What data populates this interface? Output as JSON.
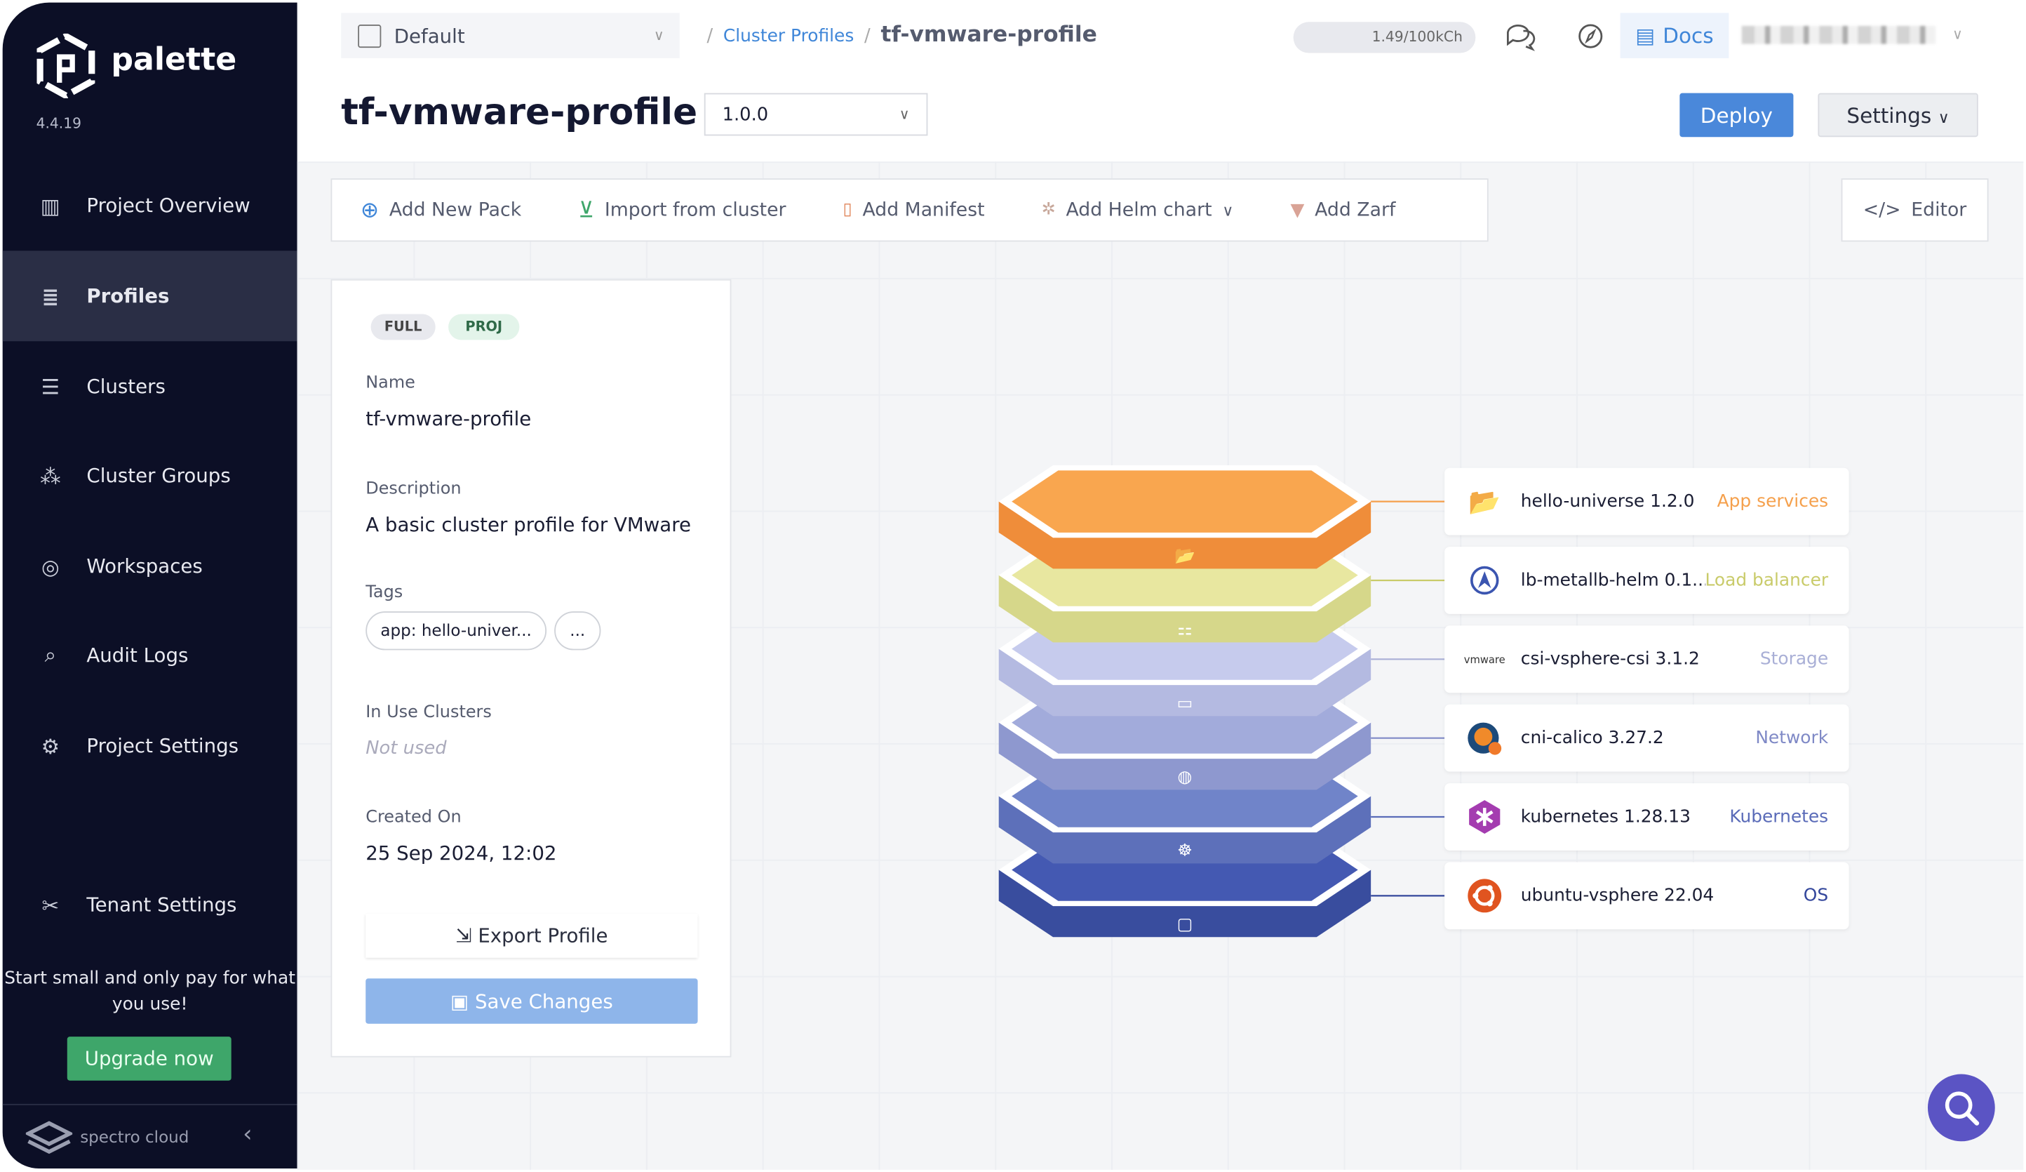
{
  "sidebar": {
    "logo": "palette",
    "version": "4.4.19",
    "items": [
      {
        "label": "Project Overview",
        "icon": "chart-icon",
        "active": false
      },
      {
        "label": "Profiles",
        "icon": "database-icon",
        "active": true
      },
      {
        "label": "Clusters",
        "icon": "server-icon",
        "active": false
      },
      {
        "label": "Cluster Groups",
        "icon": "network-icon",
        "active": false
      },
      {
        "label": "Workspaces",
        "icon": "target-icon",
        "active": false
      },
      {
        "label": "Audit Logs",
        "icon": "search-doc-icon",
        "active": false
      },
      {
        "label": "Project Settings",
        "icon": "gear-icon",
        "active": false
      },
      {
        "label": "Tenant Settings",
        "icon": "tools-icon",
        "active": false
      }
    ],
    "promo": "Start small and only pay for what you use!",
    "upgrade_label": "Upgrade now",
    "footer_logo": "spectro cloud"
  },
  "header": {
    "project": "Default",
    "breadcrumb": [
      "Cluster Profiles",
      "tf-vmware-profile"
    ],
    "usage": "1.49/100kCh",
    "docs_label": "Docs"
  },
  "profile": {
    "title": "tf-vmware-profile",
    "version": "1.0.0",
    "deploy_label": "Deploy",
    "settings_label": "Settings"
  },
  "toolbar": {
    "add_pack": "Add New Pack",
    "import": "Import from cluster",
    "manifest": "Add Manifest",
    "helm": "Add Helm chart",
    "zarf": "Add Zarf",
    "editor": "Editor"
  },
  "details": {
    "badges": [
      "FULL",
      "PROJ"
    ],
    "name_label": "Name",
    "name": "tf-vmware-profile",
    "description_label": "Description",
    "description": "A basic cluster profile for VMware",
    "tags_label": "Tags",
    "tags": [
      "app: hello-univer...",
      "..."
    ],
    "in_use_label": "In Use Clusters",
    "in_use": "Not used",
    "created_label": "Created On",
    "created": "25 Sep 2024, 12:02",
    "export_label": "Export Profile",
    "save_label": "Save Changes"
  },
  "layers": [
    {
      "name": "hello-universe 1.2.0",
      "layer": "App services",
      "color": "#f5a04c",
      "icon": "folder-icon"
    },
    {
      "name": "lb-metallb-helm 0.1...",
      "layer": "Load balancer",
      "color": "#c9cb6a",
      "icon": "metallb-icon"
    },
    {
      "name": "csi-vsphere-csi 3.1.2",
      "layer": "Storage",
      "color": "#a9afd6",
      "icon": "vmware-icon",
      "icon_text": "vmware"
    },
    {
      "name": "cni-calico 3.27.2",
      "layer": "Network",
      "color": "#7f89c6",
      "icon": "calico-icon"
    },
    {
      "name": "kubernetes 1.28.13",
      "layer": "Kubernetes",
      "color": "#5a6bb8",
      "icon": "kubernetes-icon"
    },
    {
      "name": "ubuntu-vsphere 22.04",
      "layer": "OS",
      "color": "#34479c",
      "icon": "ubuntu-icon"
    }
  ]
}
